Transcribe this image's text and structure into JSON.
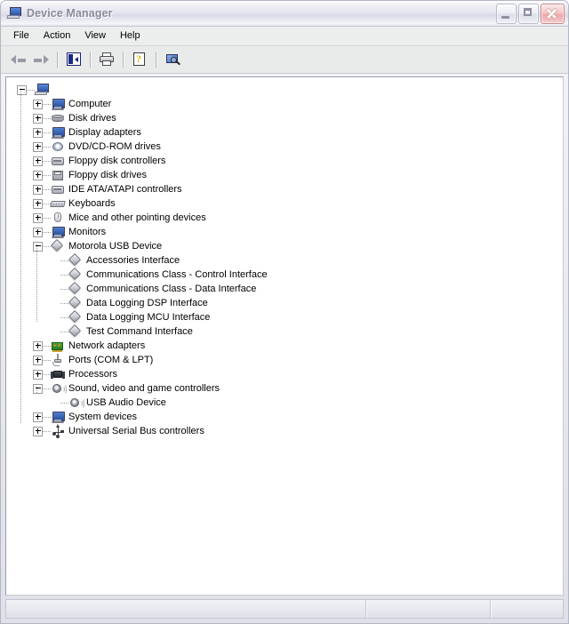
{
  "window": {
    "title": "Device Manager",
    "title_icon": "computer-monitor-icon",
    "controls": {
      "minimize": "Minimize",
      "maximize": "Maximize",
      "close": "Close"
    }
  },
  "menubar": {
    "items": [
      {
        "label": "File"
      },
      {
        "label": "Action"
      },
      {
        "label": "View"
      },
      {
        "label": "Help"
      }
    ]
  },
  "toolbar": {
    "buttons": [
      {
        "name": "back-button",
        "icon": "left-arrow-icon",
        "tooltip": "Back"
      },
      {
        "name": "forward-button",
        "icon": "right-arrow-icon",
        "tooltip": "Forward"
      },
      {
        "name": "show-hide-console-tree-button",
        "icon": "console-tree-icon",
        "tooltip": "Show/Hide Console Tree"
      },
      {
        "name": "print-button",
        "icon": "printer-icon",
        "tooltip": "Print"
      },
      {
        "name": "properties-button",
        "icon": "properties-help-icon",
        "tooltip": "Properties"
      },
      {
        "name": "scan-hardware-changes-button",
        "icon": "scan-hardware-icon",
        "tooltip": "Scan for hardware changes"
      }
    ]
  },
  "tree": {
    "root": {
      "label": "",
      "icon": "computer-root-icon",
      "expander": "minus"
    },
    "nodes": [
      {
        "label": "Computer",
        "icon": "computer-icon",
        "expander": "plus",
        "level": 1
      },
      {
        "label": "Disk drives",
        "icon": "disk-icon",
        "expander": "plus",
        "level": 1
      },
      {
        "label": "Display adapters",
        "icon": "computer-icon",
        "expander": "plus",
        "level": 1
      },
      {
        "label": "DVD/CD-ROM drives",
        "icon": "dvd-icon",
        "expander": "plus",
        "level": 1
      },
      {
        "label": "Floppy disk controllers",
        "icon": "controller-icon",
        "expander": "plus",
        "level": 1
      },
      {
        "label": "Floppy disk drives",
        "icon": "floppy-icon",
        "expander": "plus",
        "level": 1
      },
      {
        "label": "IDE ATA/ATAPI controllers",
        "icon": "controller-icon",
        "expander": "plus",
        "level": 1
      },
      {
        "label": "Keyboards",
        "icon": "keyboard-icon",
        "expander": "plus",
        "level": 1
      },
      {
        "label": "Mice and other pointing devices",
        "icon": "mouse-icon",
        "expander": "plus",
        "level": 1
      },
      {
        "label": "Monitors",
        "icon": "computer-icon",
        "expander": "plus",
        "level": 1
      },
      {
        "label": "Motorola USB Device",
        "icon": "diamond-icon",
        "expander": "minus",
        "level": 1
      },
      {
        "label": "Accessories Interface",
        "icon": "diamond-icon",
        "expander": "none",
        "level": 2
      },
      {
        "label": "Communications Class - Control Interface",
        "icon": "diamond-icon",
        "expander": "none",
        "level": 2
      },
      {
        "label": "Communications Class - Data Interface",
        "icon": "diamond-icon",
        "expander": "none",
        "level": 2
      },
      {
        "label": "Data Logging DSP Interface",
        "icon": "diamond-icon",
        "expander": "none",
        "level": 2
      },
      {
        "label": "Data Logging MCU Interface",
        "icon": "diamond-icon",
        "expander": "none",
        "level": 2
      },
      {
        "label": "Test Command Interface",
        "icon": "diamond-icon",
        "expander": "none",
        "level": 2
      },
      {
        "label": "Network adapters",
        "icon": "network-icon",
        "expander": "plus",
        "level": 1
      },
      {
        "label": "Ports (COM & LPT)",
        "icon": "port-icon",
        "expander": "plus",
        "level": 1
      },
      {
        "label": "Processors",
        "icon": "processor-icon",
        "expander": "plus",
        "level": 1
      },
      {
        "label": "Sound, video and game controllers",
        "icon": "sound-icon",
        "expander": "minus",
        "level": 1
      },
      {
        "label": "USB Audio Device",
        "icon": "sound-icon",
        "expander": "none",
        "level": 2
      },
      {
        "label": "System devices",
        "icon": "computer-icon",
        "expander": "plus",
        "level": 1
      },
      {
        "label": "Universal Serial Bus controllers",
        "icon": "usb-icon",
        "expander": "plus",
        "level": 1
      }
    ]
  },
  "statusbar": {
    "panes": [
      {
        "name": "status-pane-main",
        "text": ""
      },
      {
        "name": "status-pane-secondary",
        "text": ""
      },
      {
        "name": "status-pane-tertiary",
        "text": ""
      }
    ]
  },
  "colors": {
    "title_text": "#8a8a9a",
    "window_frame": "#b3b6c4",
    "tree_background": "#ffffff",
    "close_button": "#eda7a7",
    "network_icon": "#4fa83c"
  }
}
